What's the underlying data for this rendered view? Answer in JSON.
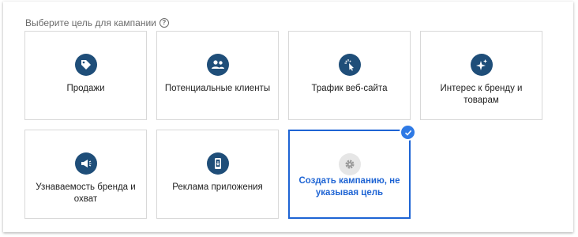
{
  "prompt": {
    "text": "Выберите цель для кампании",
    "help_glyph": "?"
  },
  "goals": [
    {
      "label": "Продажи",
      "icon": "tag-icon",
      "selected": false
    },
    {
      "label": "Потенциальные клиенты",
      "icon": "people-icon",
      "selected": false
    },
    {
      "label": "Трафик веб-сайта",
      "icon": "cursor-click-icon",
      "selected": false
    },
    {
      "label": "Интерес к бренду и товарам",
      "icon": "sparkle-icon",
      "selected": false
    },
    {
      "label": "Узнаваемость бренда и охват",
      "icon": "megaphone-icon",
      "selected": false
    },
    {
      "label": "Реклама приложения",
      "icon": "phone-icon",
      "selected": false
    },
    {
      "label": "Создать кампанию, не указывая цель",
      "icon": "gear-icon",
      "selected": true
    }
  ],
  "colors": {
    "icon_bg": "#1f4e79",
    "accent": "#1e64d4",
    "check_badge": "#2f7ae5",
    "card_border": "#d8d8d8"
  }
}
